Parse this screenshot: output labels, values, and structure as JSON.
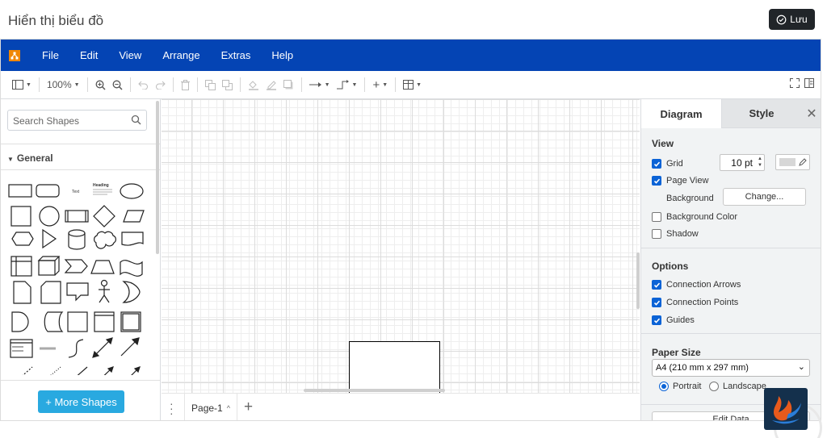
{
  "page": {
    "title": "Hiển thị biểu đồ",
    "save_label": "Lưu"
  },
  "menubar": {
    "items": [
      "File",
      "Edit",
      "View",
      "Arrange",
      "Extras",
      "Help"
    ]
  },
  "toolbar": {
    "zoom": "100%"
  },
  "sidebar": {
    "search_placeholder": "Search Shapes",
    "section_general": "General",
    "shape_text_label": "Text",
    "shape_heading_label": "Heading",
    "more_shapes_label": "+ More Shapes"
  },
  "pagebar": {
    "page_name": "Page-1"
  },
  "format": {
    "tabs": {
      "diagram": "Diagram",
      "style": "Style"
    },
    "view": {
      "title": "View",
      "grid": "Grid",
      "grid_size": "10 pt",
      "page_view": "Page View",
      "background": "Background",
      "change": "Change...",
      "background_color": "Background Color",
      "shadow": "Shadow"
    },
    "options": {
      "title": "Options",
      "connection_arrows": "Connection Arrows",
      "connection_points": "Connection Points",
      "guides": "Guides"
    },
    "paper": {
      "title": "Paper Size",
      "selected": "A4 (210 mm x 297 mm)",
      "portrait": "Portrait",
      "landscape": "Landscape",
      "edit_data": "Edit Data"
    }
  },
  "colors": {
    "menubar": "#0444b4",
    "save_button": "#212529",
    "more_shapes": "#29a9e0",
    "checkbox": "#0b63d6"
  }
}
